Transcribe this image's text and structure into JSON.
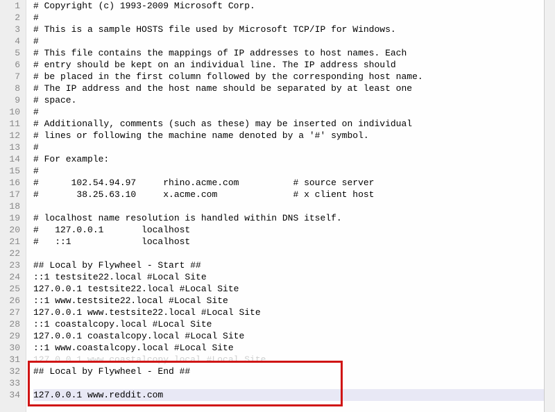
{
  "lines": [
    {
      "n": 1,
      "t": "# Copyright (c) 1993-2009 Microsoft Corp."
    },
    {
      "n": 2,
      "t": "#"
    },
    {
      "n": 3,
      "t": "# This is a sample HOSTS file used by Microsoft TCP/IP for Windows."
    },
    {
      "n": 4,
      "t": "#"
    },
    {
      "n": 5,
      "t": "# This file contains the mappings of IP addresses to host names. Each"
    },
    {
      "n": 6,
      "t": "# entry should be kept on an individual line. The IP address should"
    },
    {
      "n": 7,
      "t": "# be placed in the first column followed by the corresponding host name."
    },
    {
      "n": 8,
      "t": "# The IP address and the host name should be separated by at least one"
    },
    {
      "n": 9,
      "t": "# space."
    },
    {
      "n": 10,
      "t": "#"
    },
    {
      "n": 11,
      "t": "# Additionally, comments (such as these) may be inserted on individual"
    },
    {
      "n": 12,
      "t": "# lines or following the machine name denoted by a '#' symbol."
    },
    {
      "n": 13,
      "t": "#"
    },
    {
      "n": 14,
      "t": "# For example:"
    },
    {
      "n": 15,
      "t": "#"
    },
    {
      "n": 16,
      "t": "#      102.54.94.97     rhino.acme.com          # source server"
    },
    {
      "n": 17,
      "t": "#       38.25.63.10     x.acme.com              # x client host"
    },
    {
      "n": 18,
      "t": ""
    },
    {
      "n": 19,
      "t": "# localhost name resolution is handled within DNS itself."
    },
    {
      "n": 20,
      "t": "#   127.0.0.1       localhost"
    },
    {
      "n": 21,
      "t": "#   ::1             localhost"
    },
    {
      "n": 22,
      "t": ""
    },
    {
      "n": 23,
      "t": "## Local by Flywheel - Start ##"
    },
    {
      "n": 24,
      "t": "::1 testsite22.local #Local Site"
    },
    {
      "n": 25,
      "t": "127.0.0.1 testsite22.local #Local Site"
    },
    {
      "n": 26,
      "t": "::1 www.testsite22.local #Local Site"
    },
    {
      "n": 27,
      "t": "127.0.0.1 www.testsite22.local #Local Site"
    },
    {
      "n": 28,
      "t": "::1 coastalcopy.local #Local Site"
    },
    {
      "n": 29,
      "t": "127.0.0.1 coastalcopy.local #Local Site"
    },
    {
      "n": 30,
      "t": "::1 www.coastalcopy.local #Local Site"
    },
    {
      "n": 31,
      "t": "127.0.0.1 www.coastalcopy.local #Local Site",
      "obscured": true
    },
    {
      "n": 32,
      "t": "## Local by Flywheel - End ##"
    },
    {
      "n": 33,
      "t": ""
    },
    {
      "n": 34,
      "t": "127.0.0.1 www.reddit.com",
      "current": true
    }
  ]
}
